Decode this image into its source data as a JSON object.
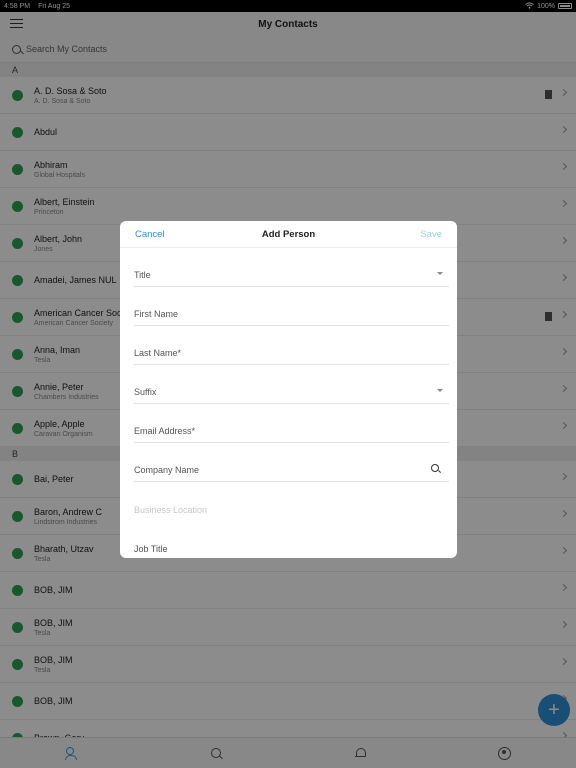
{
  "status_bar": {
    "time": "4:58 PM",
    "date": "Fri Aug 25",
    "battery": "100%"
  },
  "header": {
    "title": "My Contacts"
  },
  "search": {
    "placeholder": "Search My Contacts"
  },
  "sections": [
    {
      "letter": "A",
      "contacts": [
        {
          "name": "A. D. Sosa & Soto",
          "sub": "A. D. Sosa & Soto",
          "doc": true
        },
        {
          "name": "Abdul",
          "sub": ""
        },
        {
          "name": "Abhiram",
          "sub": "Global Hospitals"
        },
        {
          "name": "Albert, Einstein",
          "sub": "Princeton"
        },
        {
          "name": "Albert, John",
          "sub": "Jones"
        },
        {
          "name": "Amadei, James NUL",
          "sub": ""
        },
        {
          "name": "American Cancer Society",
          "sub": "American Cancer Society",
          "doc": true
        },
        {
          "name": "Anna, Iman",
          "sub": "Tesla"
        },
        {
          "name": "Annie, Peter",
          "sub": "Chambers Industries"
        },
        {
          "name": "Apple, Apple",
          "sub": "Caravan Organism"
        }
      ]
    },
    {
      "letter": "B",
      "contacts": [
        {
          "name": "Bai, Peter",
          "sub": ""
        },
        {
          "name": "Baron, Andrew C",
          "sub": "Lindstrom Industries"
        },
        {
          "name": "Bharath, Utzav",
          "sub": "Tesla"
        },
        {
          "name": "BOB, JIM",
          "sub": ""
        },
        {
          "name": "BOB, JIM",
          "sub": "Tesla"
        },
        {
          "name": "BOB, JIM",
          "sub": "Tesla"
        },
        {
          "name": "BOB, JIM",
          "sub": ""
        },
        {
          "name": "Brown, Gary",
          "sub": ""
        }
      ]
    }
  ],
  "modal": {
    "cancel": "Cancel",
    "title": "Add Person",
    "save": "Save",
    "fields": {
      "title": "Title",
      "first_name": "First Name",
      "last_name": "Last Name*",
      "suffix": "Suffix",
      "email": "Email Address*",
      "company": "Company Name",
      "business_location": "Business Location",
      "job_title": "Job Title"
    }
  },
  "fab": {
    "label": "+"
  },
  "colors": {
    "accent": "#2f8fd6",
    "contact_dot": "#2e9e56",
    "save_disabled": "#9bd0ee"
  }
}
